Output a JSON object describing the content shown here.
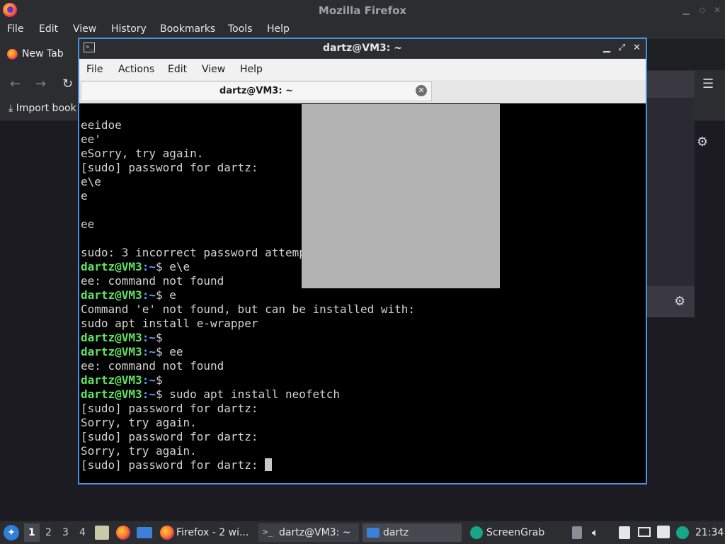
{
  "firefox": {
    "window_title": "Mozilla Firefox",
    "menu": [
      "File",
      "Edit",
      "View",
      "History",
      "Bookmarks",
      "Tools",
      "Help"
    ],
    "tab_label": "New Tab",
    "bookmark_label": "Import book"
  },
  "terminal": {
    "window_title": "dartz@VM3: ~",
    "menu": [
      "File",
      "Actions",
      "Edit",
      "View",
      "Help"
    ],
    "tab_label": "dartz@VM3: ~",
    "prompt_user": "dartz@VM3",
    "prompt_path": ":~",
    "lines": [
      {
        "type": "out",
        "text": "eeidoe"
      },
      {
        "type": "out",
        "text": "ee'"
      },
      {
        "type": "out",
        "text": "eSorry, try again."
      },
      {
        "type": "out",
        "text": "[sudo] password for dartz:"
      },
      {
        "type": "out",
        "text": "e\\e"
      },
      {
        "type": "out",
        "text": "e"
      },
      {
        "type": "out",
        "text": ""
      },
      {
        "type": "out",
        "text": "ee"
      },
      {
        "type": "out",
        "text": ""
      },
      {
        "type": "out",
        "text": "sudo: 3 incorrect password attempts"
      },
      {
        "type": "cmd",
        "text": "$ e\\e"
      },
      {
        "type": "out",
        "text": "ee: command not found"
      },
      {
        "type": "cmd",
        "text": "$ e"
      },
      {
        "type": "out",
        "text": "Command 'e' not found, but can be installed with:"
      },
      {
        "type": "out",
        "text": "sudo apt install e-wrapper"
      },
      {
        "type": "cmd",
        "text": "$"
      },
      {
        "type": "cmd",
        "text": "$ ee"
      },
      {
        "type": "out",
        "text": "ee: command not found"
      },
      {
        "type": "cmd",
        "text": "$"
      },
      {
        "type": "cmd",
        "text": "$ sudo apt install neofetch"
      },
      {
        "type": "out",
        "text": "[sudo] password for dartz:"
      },
      {
        "type": "out",
        "text": "Sorry, try again."
      },
      {
        "type": "out",
        "text": "[sudo] password for dartz:"
      },
      {
        "type": "out",
        "text": "Sorry, try again."
      },
      {
        "type": "out",
        "text": "[sudo] password for dartz: ",
        "cursor": true
      }
    ]
  },
  "taskbar": {
    "workspaces": [
      "1",
      "2",
      "3",
      "4"
    ],
    "tasks": [
      {
        "label": "Firefox - 2 wi..."
      },
      {
        "label": "dartz@VM3: ~"
      },
      {
        "label": "dartz"
      },
      {
        "label": "ScreenGrab"
      }
    ],
    "clock": "21:34"
  },
  "colors": {
    "prompt_user": "#5fe35f",
    "prompt_path": "#6b9cff",
    "terminal_border": "#4a90e2"
  }
}
